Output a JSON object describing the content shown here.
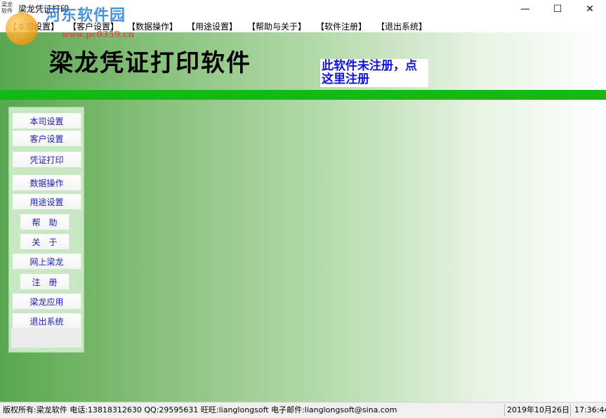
{
  "window": {
    "title": "梁龙凭证打印",
    "icon_text": "梁龙软件",
    "controls": {
      "minimize": "—",
      "maximize": "☐",
      "close": "✕"
    }
  },
  "watermark": {
    "site": "河东软件园",
    "url": "www.pc0359.cn"
  },
  "menu": {
    "items": [
      {
        "label": "【本司设置】"
      },
      {
        "label": "【客户设置】"
      },
      {
        "label": "【数据操作】"
      },
      {
        "label": "【用途设置】"
      },
      {
        "label": "【帮助与关于】"
      },
      {
        "label": "【软件注册】"
      },
      {
        "label": "【退出系统】"
      }
    ]
  },
  "header": {
    "title": "梁龙凭证打印软件",
    "register_notice": "此软件未注册，点这里注册"
  },
  "sidebar": {
    "items": [
      {
        "label": "本司设置"
      },
      {
        "label": "客户设置"
      },
      {
        "label": "凭证打印"
      },
      {
        "label": "数据操作"
      },
      {
        "label": "用途设置"
      },
      {
        "label": "帮　助"
      },
      {
        "label": "关　于"
      },
      {
        "label": "网上梁龙"
      },
      {
        "label": "注　册"
      },
      {
        "label": "梁龙应用"
      },
      {
        "label": "退出系统"
      }
    ]
  },
  "statusbar": {
    "info": "版权所有:梁龙软件 电话:13818312630 QQ:29595631 旺旺:lianglongsoft 电子邮件:lianglongsoft@sina.com",
    "date": "2019年10月26日",
    "time": "17:36:44"
  },
  "colors": {
    "accent_bar": "#14b814",
    "register_text": "#1212d9",
    "sidebar_bg": "#c7e8c3",
    "sidebar_text": "#1b1bb5"
  }
}
